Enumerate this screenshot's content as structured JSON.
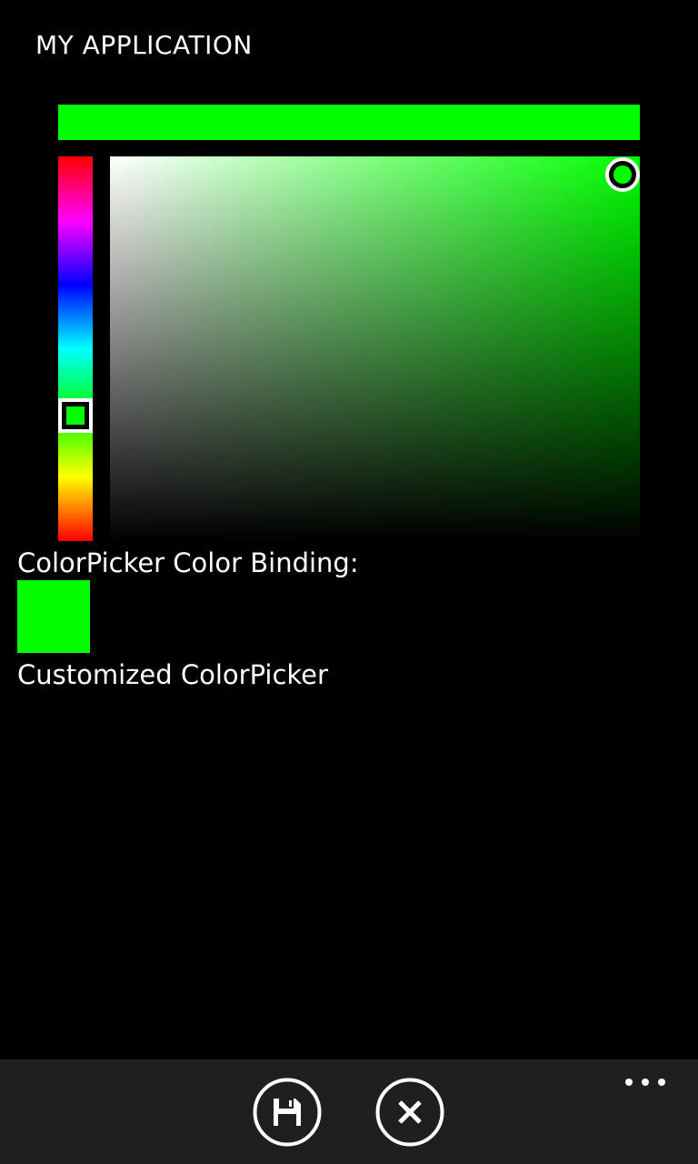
{
  "app": {
    "title": "MY APPLICATION"
  },
  "color_picker": {
    "selected_color": "#00ff00",
    "hue_gradient": [
      "#ff0000",
      "#ff00ff",
      "#0000ff",
      "#00ffff",
      "#00ff00",
      "#ffff00",
      "#ff0000"
    ]
  },
  "binding": {
    "label": "ColorPicker Color Binding:",
    "swatch_color": "#00ff00"
  },
  "custom": {
    "label": "Customized ColorPicker"
  },
  "app_bar": {
    "buttons": [
      {
        "icon": "save-icon"
      },
      {
        "icon": "close-icon"
      }
    ],
    "more_icon": "ellipsis-icon"
  }
}
